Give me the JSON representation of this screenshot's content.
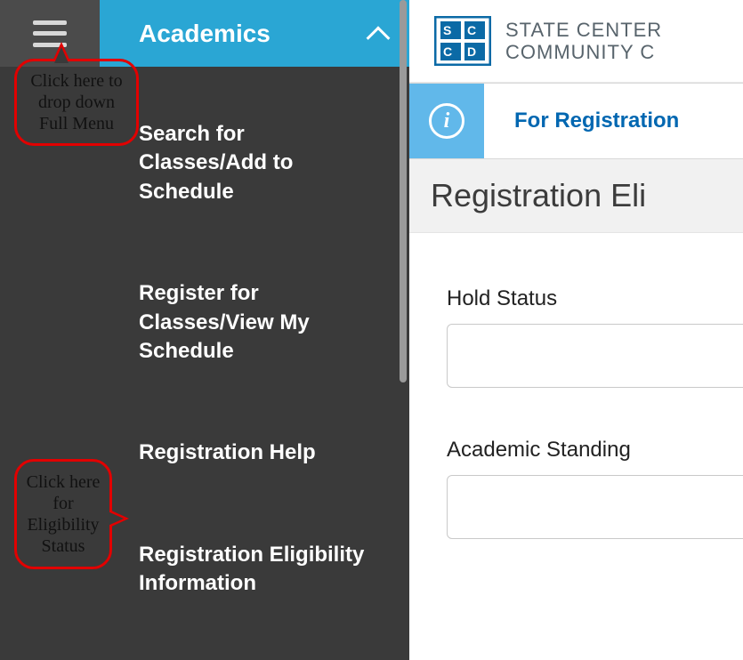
{
  "sidebar": {
    "header": "Academics",
    "items": [
      {
        "label": "Search for Classes/Add to Schedule"
      },
      {
        "label": "Register for Classes/View My Schedule"
      },
      {
        "label": "Registration Help"
      },
      {
        "label": "Registration Eligibility Information"
      }
    ]
  },
  "brand": {
    "line1": "STATE CENTER",
    "line2": "COMMUNITY C"
  },
  "banner": {
    "link_text": "For Registration"
  },
  "page": {
    "title": "Registration Eli"
  },
  "fields": {
    "hold_status": {
      "label": "Hold Status",
      "value": ""
    },
    "academic_standing": {
      "label": "Academic Standing",
      "value": ""
    }
  },
  "annotations": {
    "menu_callout": "Click here to drop down Full Menu",
    "eligibility_callout": "Click here for Eligibility Status"
  }
}
